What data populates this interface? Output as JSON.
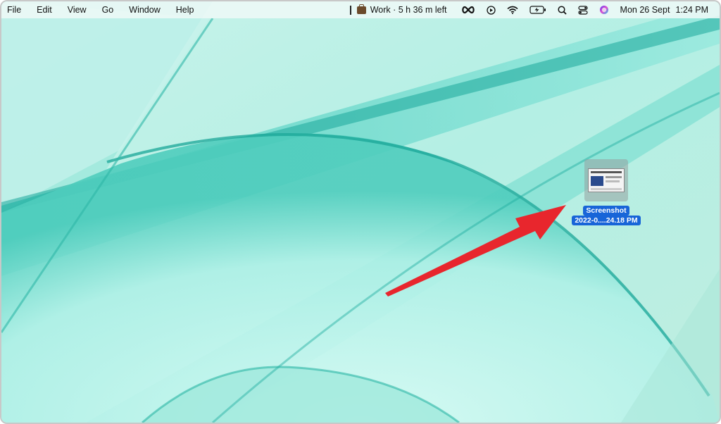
{
  "menubar": {
    "menus": [
      "File",
      "Edit",
      "View",
      "Go",
      "Window",
      "Help"
    ],
    "focus_status": "Work · 5 h 36 m left",
    "icons": [
      "infinity-icon",
      "play-circle-icon",
      "wifi-icon",
      "battery-charging-icon",
      "search-icon",
      "control-center-icon",
      "siri-icon"
    ],
    "date": "Mon 26 Sept",
    "time": "1:24 PM"
  },
  "desktop": {
    "file": {
      "name_line1": "Screenshot",
      "name_line2": "2022-0....24.18 PM"
    }
  },
  "colors": {
    "accent": "#1865d8",
    "annotation_arrow": "#e8262d"
  }
}
